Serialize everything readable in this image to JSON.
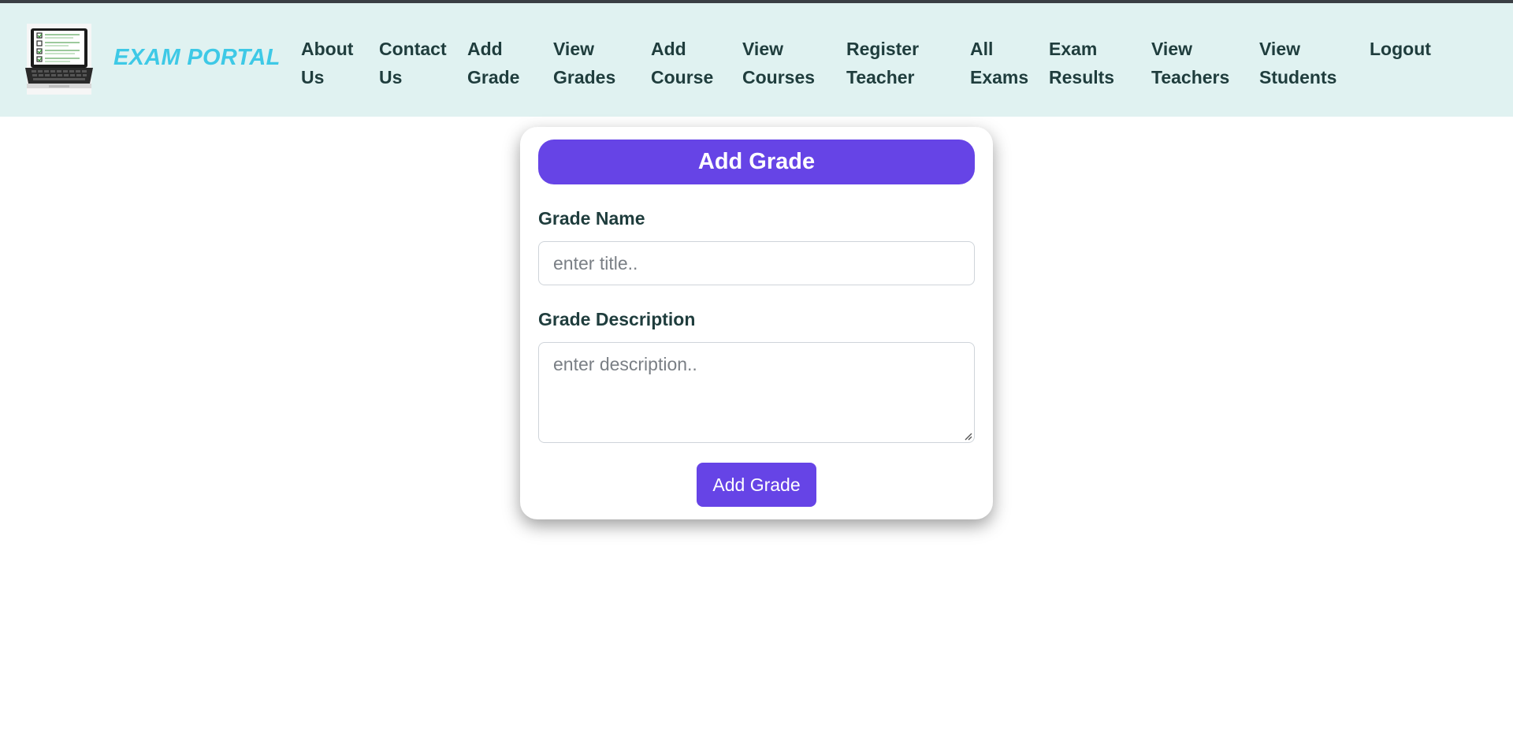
{
  "brand": {
    "name": "EXAM PORTAL",
    "logo_icon": "laptop-checklist-icon"
  },
  "nav": {
    "items": [
      {
        "line1": "About",
        "line2": "Us"
      },
      {
        "line1": "Contact",
        "line2": "Us"
      },
      {
        "line1": "Add",
        "line2": "Grade"
      },
      {
        "line1": "View",
        "line2": "Grades"
      },
      {
        "line1": "Add",
        "line2": "Course"
      },
      {
        "line1": "View",
        "line2": "Courses"
      },
      {
        "line1": "Register",
        "line2": "Teacher"
      },
      {
        "line1": "All",
        "line2": "Exams"
      },
      {
        "line1": "Exam",
        "line2": "Results"
      },
      {
        "line1": "View",
        "line2": "Teachers"
      },
      {
        "line1": "View",
        "line2": "Students"
      },
      {
        "line1": "Logout",
        "line2": ""
      }
    ]
  },
  "form": {
    "title": "Add Grade",
    "name_label": "Grade Name",
    "name_placeholder": "enter title..",
    "name_value": "",
    "description_label": "Grade Description",
    "description_placeholder": "enter description..",
    "description_value": "",
    "submit_label": "Add Grade"
  },
  "colors": {
    "navbar_bg": "#e0f2f1",
    "brand_text": "#3ec9e6",
    "nav_text": "#1f3d3d",
    "accent": "#6644e6",
    "top_border": "#3a3f44"
  }
}
